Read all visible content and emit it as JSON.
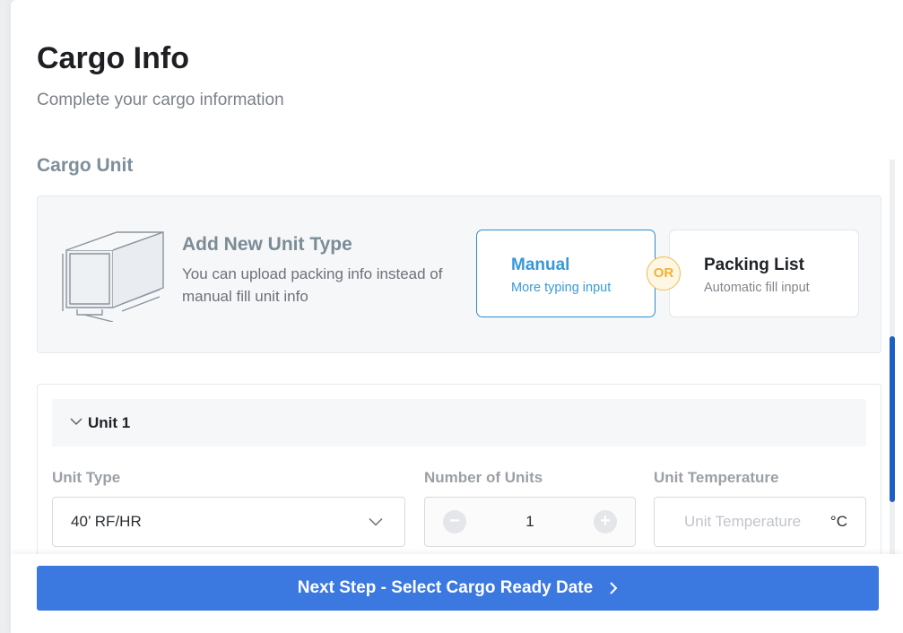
{
  "page": {
    "title": "Cargo Info",
    "subtitle": "Complete your cargo information"
  },
  "cargo_unit": {
    "section_title": "Cargo Unit",
    "add_new": {
      "title": "Add New Unit Type",
      "description": "You can upload packing info instead of manual fill unit info"
    },
    "options": {
      "manual": {
        "title": "Manual",
        "subtitle": "More typing input",
        "selected": true
      },
      "or_label": "OR",
      "packing_list": {
        "title": "Packing List",
        "subtitle": "Automatic fill input",
        "selected": false
      }
    }
  },
  "unit": {
    "header": "Unit 1",
    "expanded": true,
    "fields": {
      "unit_type": {
        "label": "Unit Type",
        "value": "40’ RF/HR"
      },
      "number_of_units": {
        "label": "Number of Units",
        "value": "1",
        "minus": "−",
        "plus": "+"
      },
      "unit_temperature": {
        "label": "Unit Temperature",
        "placeholder": "Unit Temperature",
        "unit": "°C"
      }
    }
  },
  "footer": {
    "next_button": "Next Step - Select Cargo Ready Date"
  },
  "icons": {
    "container": "container-icon",
    "unit_chevron": "chevron-down-icon",
    "dropdown": "chevron-down-icon",
    "next": "chevron-right-icon"
  },
  "colors": {
    "primary_button": "#3b78e0",
    "accent_blue": "#3598d9",
    "or_badge": "#f2b134",
    "scroll_thumb": "#1b5fc4"
  }
}
